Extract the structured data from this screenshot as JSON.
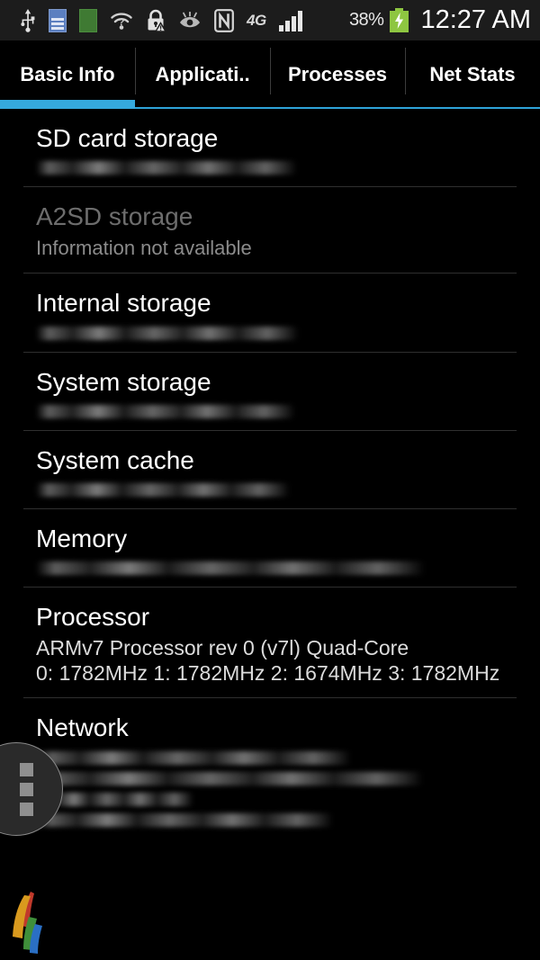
{
  "statusbar": {
    "icons": [
      {
        "name": "usb-icon"
      },
      {
        "name": "document-sync-icon"
      },
      {
        "name": "green-square-icon"
      },
      {
        "name": "wifi-question-icon"
      },
      {
        "name": "lock-warning-icon"
      },
      {
        "name": "eye-icon"
      },
      {
        "name": "nfc-icon"
      }
    ],
    "network_type": "4G",
    "signal_icon": "signal-bars-icon",
    "battery_percent": "38%",
    "battery_icon": "battery-charging-icon",
    "clock": "12:27 AM"
  },
  "tabs": [
    {
      "label": "Basic Info",
      "active": true
    },
    {
      "label": "Applicati..",
      "active": false
    },
    {
      "label": "Processes",
      "active": false
    },
    {
      "label": "Net Stats",
      "active": false
    }
  ],
  "sections": [
    {
      "title": "SD card storage",
      "dimmed": false,
      "value_redacted": true,
      "redacted_lines": [
        72
      ],
      "value": ""
    },
    {
      "title": "A2SD storage",
      "dimmed": true,
      "value_redacted": false,
      "value": "Information not available"
    },
    {
      "title": "Internal storage",
      "dimmed": false,
      "value_redacted": true,
      "redacted_lines": [
        72
      ],
      "value": ""
    },
    {
      "title": "System storage",
      "dimmed": false,
      "value_redacted": true,
      "redacted_lines": [
        70
      ],
      "value": ""
    },
    {
      "title": "System cache",
      "dimmed": false,
      "value_redacted": true,
      "redacted_lines": [
        68
      ],
      "value": ""
    },
    {
      "title": "Memory",
      "dimmed": false,
      "value_redacted": true,
      "redacted_lines": [
        84
      ],
      "value": ""
    }
  ],
  "processor": {
    "title": "Processor",
    "model": "ARMv7 Processor rev 0 (v7l) Quad-Core",
    "clocks": "0: 1782MHz  1: 1782MHz  2: 1674MHz  3: 1782MHz"
  },
  "network": {
    "title": "Network",
    "redacted_lines": [
      76,
      82,
      45,
      52
    ]
  },
  "overlay": {
    "name": "floating-overlay-handle"
  },
  "colors": {
    "accent_blue": "#35a9dd",
    "tab_underline_blue": "#2ea3d8",
    "statusbar_bg": "#1c1c1c",
    "page_bg": "#000000",
    "battery_green": "#8ec641",
    "separator": "#2f2f2f"
  }
}
